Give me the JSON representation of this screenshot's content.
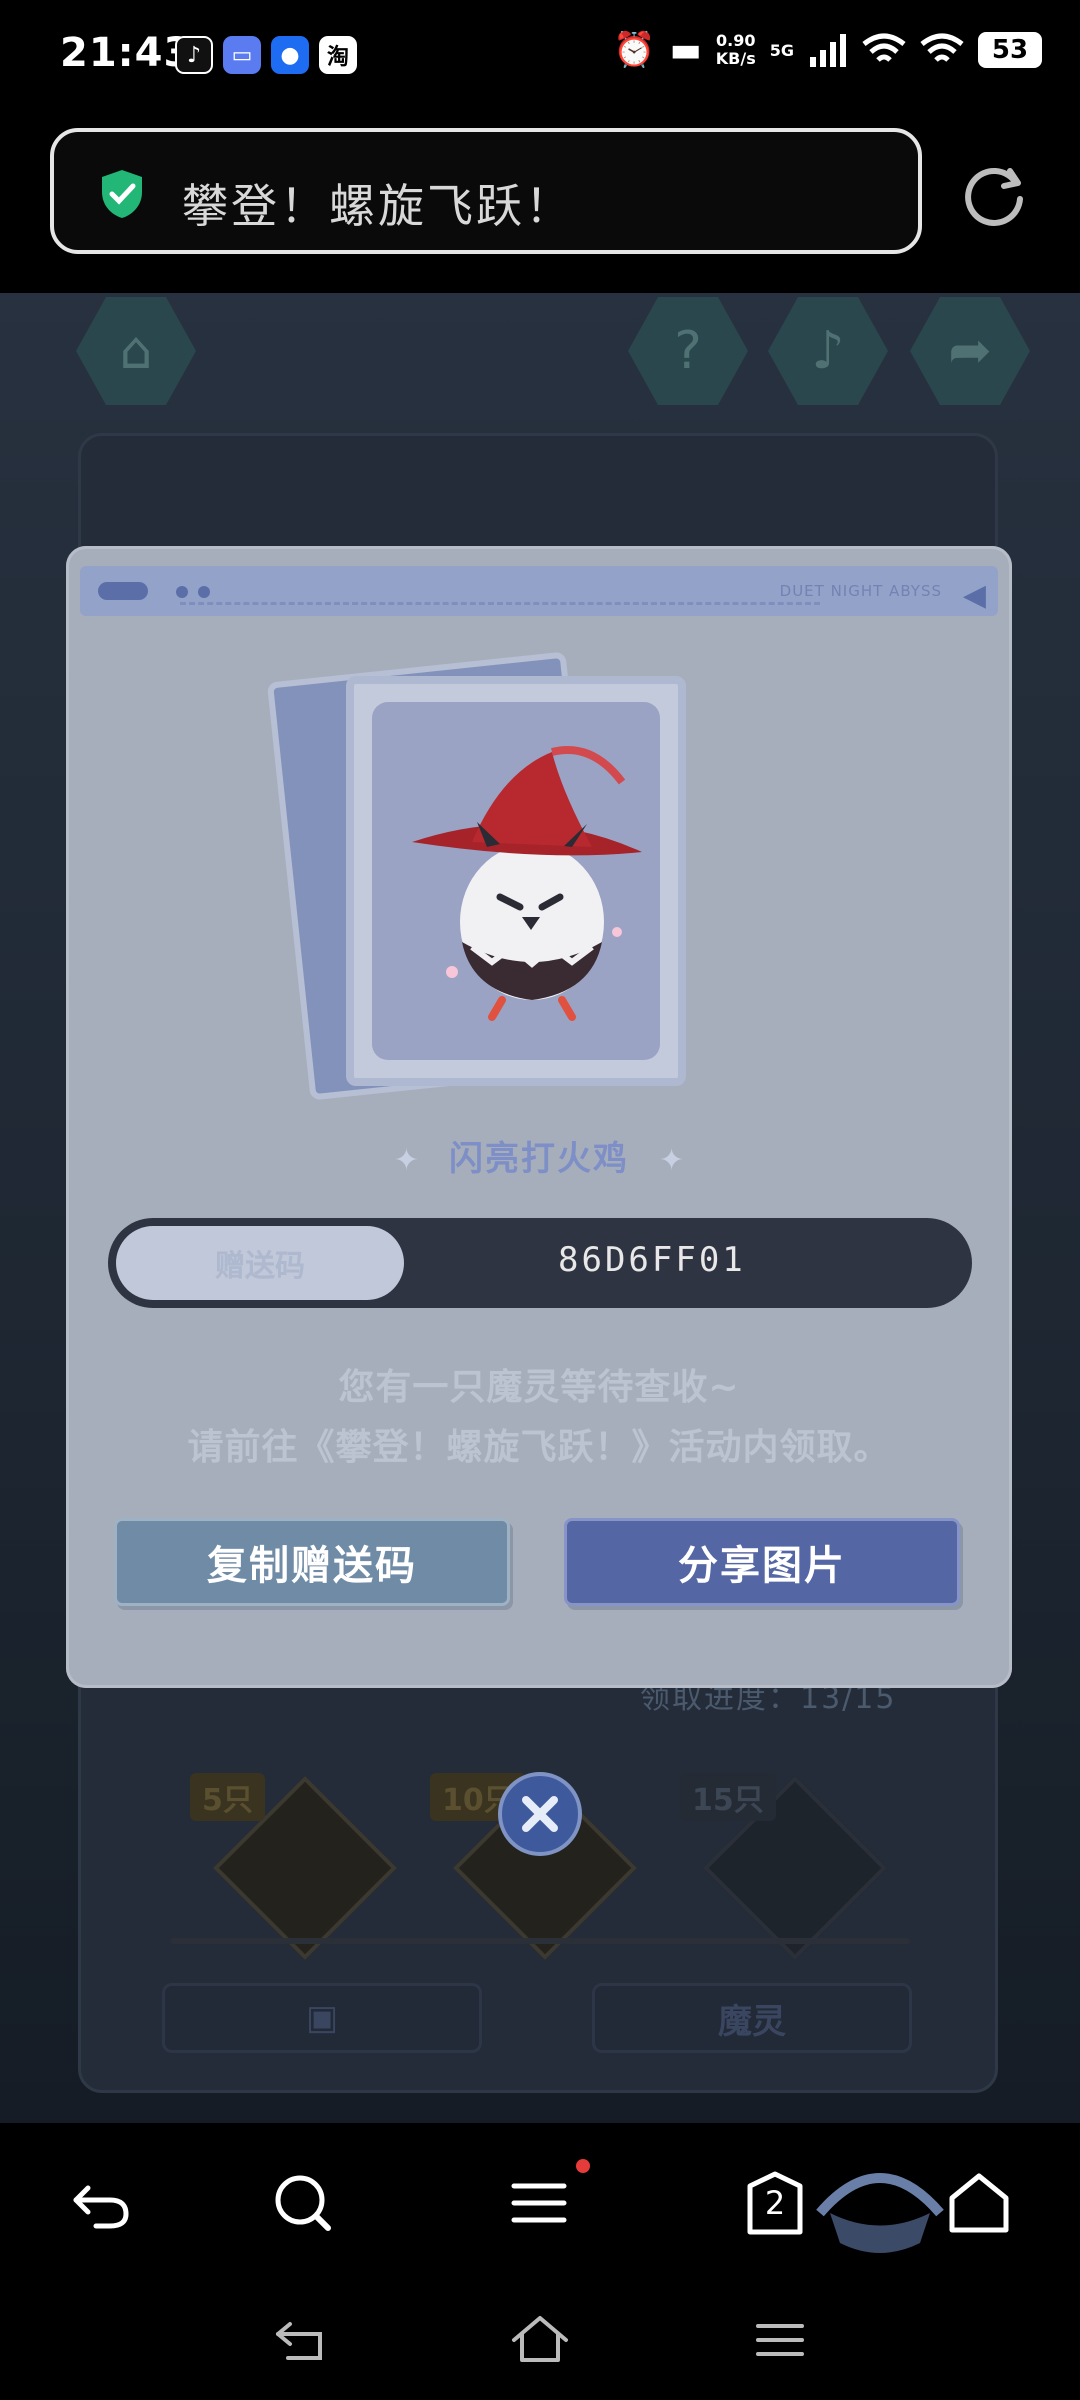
{
  "status_bar": {
    "time": "21:43",
    "app_icons": [
      "tiktok-icon",
      "message-app-icon",
      "browser-app-icon",
      "taobao-icon"
    ],
    "taobao_label": "淘",
    "net_speed_value": "0.90",
    "net_speed_unit": "KB/s",
    "network": "5G",
    "battery": "53"
  },
  "address_bar": {
    "title": "攀登！螺旋飞跃！",
    "security_icon": "shield-check-icon",
    "refresh_icon": "refresh-icon"
  },
  "game_page": {
    "milestones": [
      {
        "label": "5只"
      },
      {
        "label": "10只"
      },
      {
        "label": "15只"
      }
    ],
    "progress_text": "领取进度：13/15",
    "bottom_button_right": "魔灵"
  },
  "popup": {
    "brand": "DUET NIGHT ABYSS",
    "pet_name": "闪亮打火鸡",
    "code_label": "赠送码",
    "code_value": "86D6FF01",
    "message_line1": "您有一只魔灵等待查收~",
    "message_line2": "请前往《攀登！螺旋飞跃！》活动内领取。",
    "copy_button": "复制赠送码",
    "share_button": "分享图片"
  },
  "toolbar": {
    "tab_count": "2"
  },
  "colors": {
    "popup_bg": "#a7aebb",
    "code_bar": "#2f3442",
    "copy_btn": "#6f8ba6",
    "share_btn": "#5566a4",
    "close_btn": "#3f5a9c"
  }
}
